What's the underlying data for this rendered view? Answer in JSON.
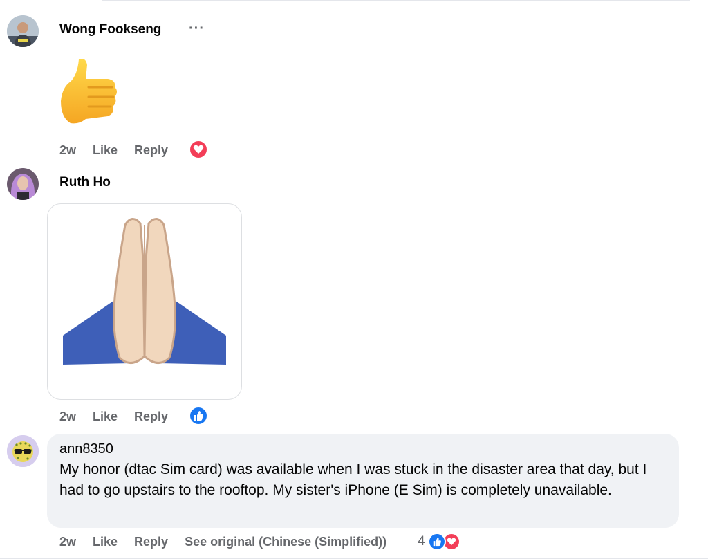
{
  "comments": [
    {
      "author": "Wong Fookseng",
      "more_label": "···",
      "sticker": "thumbs-up",
      "time": "2w",
      "like_label": "Like",
      "reply_label": "Reply",
      "reaction": "love-icon",
      "reaction_color": "#f33e58"
    },
    {
      "author": "Ruth Ho",
      "sticker": "folded-hands",
      "time": "2w",
      "like_label": "Like",
      "reply_label": "Reply",
      "reaction": "like-icon",
      "reaction_color": "#1877f2"
    },
    {
      "author": "ann8350",
      "text": "My honor (dtac Sim card) was available when I was stuck in the disaster area that day, but I had to go upstairs to the rooftop. My sister's iPhone (E Sim) is completely unavailable.",
      "time": "2w",
      "like_label": "Like",
      "reply_label": "Reply",
      "see_original_label": "See original (Chinese (Simplified))",
      "reaction_count": "4",
      "reactions": [
        "like-icon",
        "love-icon"
      ]
    }
  ]
}
